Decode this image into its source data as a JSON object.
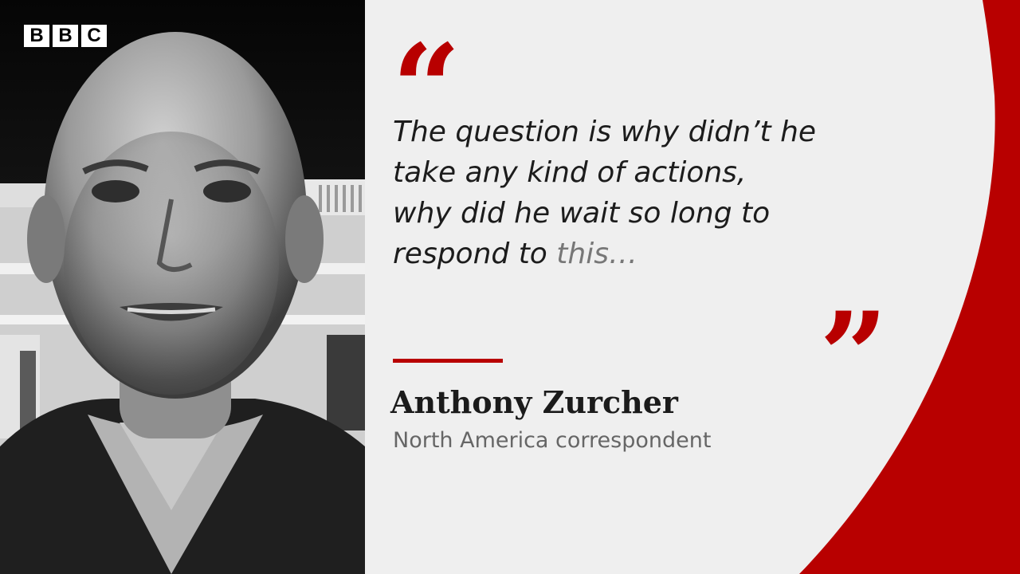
{
  "broadcaster": {
    "logo_letters": [
      "B",
      "B",
      "C"
    ]
  },
  "quote": {
    "open_mark": "“",
    "close_mark": "”",
    "lines": [
      "The question is why didn’t he",
      "take any kind of actions,",
      "why did he wait so long to"
    ],
    "last_line_main": "respond to ",
    "last_line_fade": "this…"
  },
  "speaker": {
    "name": "Anthony Zurcher",
    "role": "North America correspondent"
  },
  "colors": {
    "accent_red": "#b80000",
    "card_background": "#efefef",
    "text_dark": "#1c1c1c",
    "text_muted": "#666666"
  },
  "icons": {
    "logo": "bbc-logo",
    "open_quote": "open-quote-icon",
    "close_quote": "close-quote-icon"
  }
}
